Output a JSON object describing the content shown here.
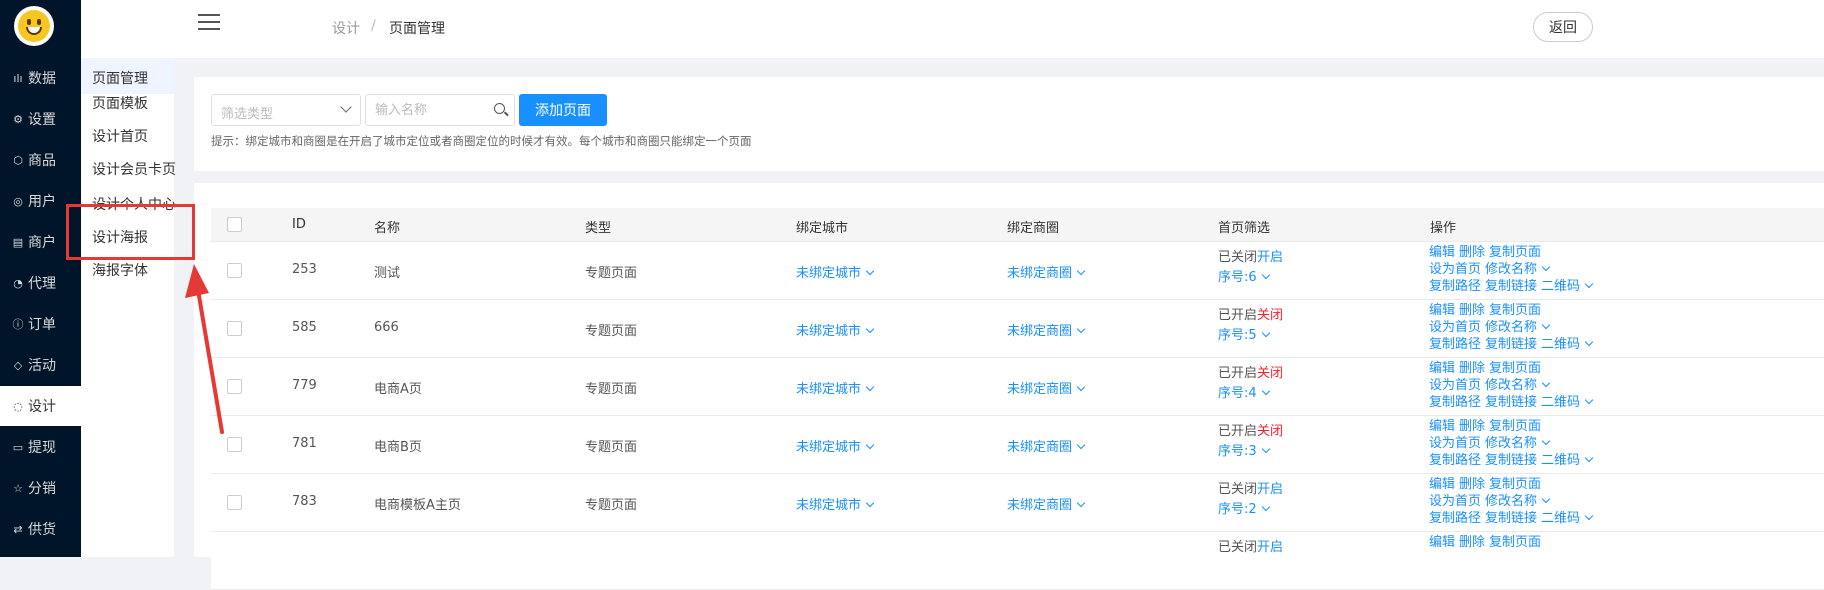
{
  "sidebar": {
    "items": [
      {
        "icon": "bar-chart-icon",
        "glyph": "ılı",
        "label": "数据"
      },
      {
        "icon": "gear-icon",
        "glyph": "⚙",
        "label": "设置"
      },
      {
        "icon": "box-icon",
        "glyph": "⬡",
        "label": "商品"
      },
      {
        "icon": "user-icon",
        "glyph": "◎",
        "label": "用户"
      },
      {
        "icon": "store-icon",
        "glyph": "▤",
        "label": "商户"
      },
      {
        "icon": "agent-icon",
        "glyph": "◔",
        "label": "代理"
      },
      {
        "icon": "order-icon",
        "glyph": "ⓘ",
        "label": "订单"
      },
      {
        "icon": "tag-icon",
        "glyph": "◇",
        "label": "活动"
      },
      {
        "icon": "palette-icon",
        "glyph": "◌",
        "label": "设计"
      },
      {
        "icon": "wallet-icon",
        "glyph": "▭",
        "label": "提现"
      },
      {
        "icon": "star-icon",
        "glyph": "☆",
        "label": "分销"
      },
      {
        "icon": "exchange-icon",
        "glyph": "⇄",
        "label": "供货"
      }
    ]
  },
  "subnav": {
    "items": [
      "页面管理",
      "页面模板",
      "设计首页",
      "设计会员卡页",
      "设计个人中心",
      "设计海报",
      "海报字体"
    ]
  },
  "breadcrumb": {
    "parent": "设计",
    "separator": "/",
    "current": "页面管理"
  },
  "header": {
    "back_label": "返回"
  },
  "filters": {
    "type_placeholder": "筛选类型",
    "name_placeholder": "输入名称",
    "add_label": "添加页面",
    "tip": "提示：绑定城市和商圈是在开启了城市定位或者商圈定位的时候才有效。每个城市和商圈只能绑定一个页面"
  },
  "table": {
    "headers": [
      "ID",
      "名称",
      "类型",
      "绑定城市",
      "绑定商圈",
      "首页筛选",
      "操作"
    ],
    "ops": {
      "line1": [
        "编辑",
        "删除",
        "复制页面"
      ],
      "line2": [
        "设为首页",
        "修改名称"
      ],
      "line3": [
        "复制路径",
        "复制链接",
        "二维码"
      ]
    },
    "rows": [
      {
        "id": "253",
        "name": "测试",
        "type": "专题页面",
        "city": "未绑定城市",
        "district": "未绑定商圈",
        "status": "已关闭",
        "toggle": "开启",
        "toggle_color": "#1890ff",
        "seq": "序号:6"
      },
      {
        "id": "585",
        "name": "666",
        "type": "专题页面",
        "city": "未绑定城市",
        "district": "未绑定商圈",
        "status": "已开启",
        "toggle": "关闭",
        "toggle_color": "#f5222d",
        "seq": "序号:5"
      },
      {
        "id": "779",
        "name": "电商A页",
        "type": "专题页面",
        "city": "未绑定城市",
        "district": "未绑定商圈",
        "status": "已开启",
        "toggle": "关闭",
        "toggle_color": "#f5222d",
        "seq": "序号:4"
      },
      {
        "id": "781",
        "name": "电商B页",
        "type": "专题页面",
        "city": "未绑定城市",
        "district": "未绑定商圈",
        "status": "已开启",
        "toggle": "关闭",
        "toggle_color": "#f5222d",
        "seq": "序号:3"
      },
      {
        "id": "783",
        "name": "电商模板A主页",
        "type": "专题页面",
        "city": "未绑定城市",
        "district": "未绑定商圈",
        "status": "已关闭",
        "toggle": "开启",
        "toggle_color": "#1890ff",
        "seq": "序号:2"
      },
      {
        "id": "",
        "name": "",
        "type": "",
        "city": "",
        "district": "",
        "status": "已关闭",
        "toggle": "开启",
        "toggle_color": "#1890ff",
        "seq": ""
      }
    ]
  },
  "colors": {
    "sidebar_bg": "#001529",
    "primary": "#1890ff",
    "danger": "#f5222d",
    "annotation": "#e53935"
  }
}
